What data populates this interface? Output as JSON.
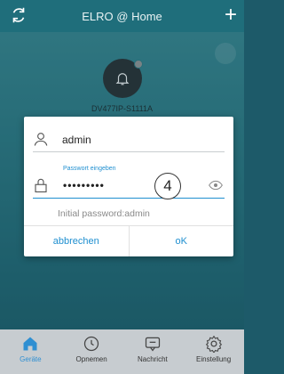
{
  "header": {
    "title": "ELRO @ Home",
    "add_symbol": "+"
  },
  "device": {
    "name": "DV477IP-S1111A"
  },
  "dialog": {
    "username": "admin",
    "password_label": "Passwort eingeben",
    "password_masked": "•••••••••",
    "step_marker": "4",
    "hint": "Initial password:admin",
    "cancel_label": "abbrechen",
    "ok_label": "oK"
  },
  "nav": {
    "items": [
      {
        "label": "Geräte",
        "icon": "home-icon",
        "active": true
      },
      {
        "label": "Opnemen",
        "icon": "clock-icon",
        "active": false
      },
      {
        "label": "Nachricht",
        "icon": "message-icon",
        "active": false
      },
      {
        "label": "Einstellung",
        "icon": "gear-icon",
        "active": false
      }
    ]
  },
  "colors": {
    "accent": "#1f8fd0",
    "header": "#1f6e7b",
    "nav_bg": "#c7ccd0"
  }
}
